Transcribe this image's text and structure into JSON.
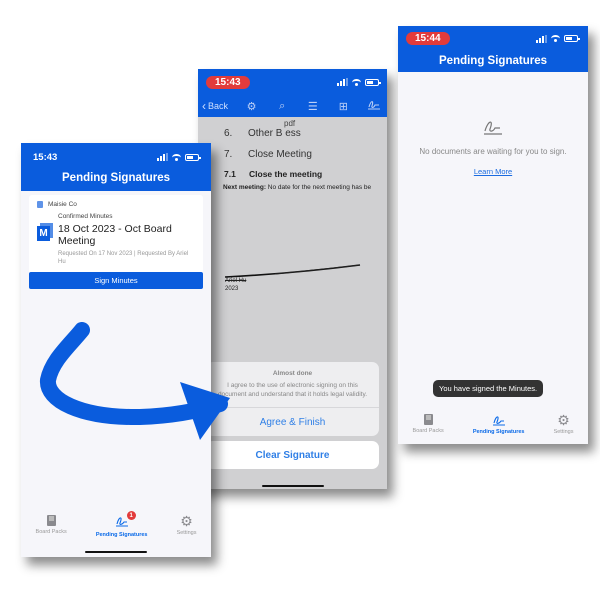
{
  "colors": {
    "brand_blue": "#0a5cdd",
    "badge_red": "#e23b3b",
    "link_blue": "#2f7fe6",
    "arrow_blue": "#0a5cdd"
  },
  "phone1": {
    "status_time": "15:43",
    "title": "Pending Signatures",
    "card": {
      "organization": "Maisie Co",
      "doc_type": "Confirmed Minutes",
      "doc_icon_letter": "M",
      "doc_title": "18 Oct 2023 - Oct Board Meeting",
      "meta": "Requested On 17 Nov 2023 | Requested By Ariel Hu",
      "action_label": "Sign Minutes"
    },
    "tabs": [
      {
        "label": "Board Packs",
        "icon": "book-icon",
        "active": false
      },
      {
        "label": "Pending Signatures",
        "icon": "signature-icon",
        "active": true,
        "badge": "1"
      },
      {
        "label": "Settings",
        "icon": "gear-icon",
        "active": false
      }
    ]
  },
  "phone2": {
    "status_time": "15:43",
    "toolbar": {
      "back_label": "Back",
      "icons": [
        "gear-icon",
        "search-icon",
        "list-icon",
        "grid-icon",
        "signature-icon"
      ]
    },
    "document": {
      "watermark": "pdf",
      "items": [
        {
          "num": "6.",
          "text": "Other B   ess"
        },
        {
          "num": "7.",
          "text": "Close Meeting"
        }
      ],
      "subitem": {
        "num": "7.1",
        "text": "Close the meeting"
      },
      "next_meeting_label": "Next meeting:",
      "next_meeting_text": " No date for the next meeting has be",
      "signer_name": "Ariel Hu",
      "signature_year": "2023"
    },
    "action_sheet": {
      "title": "Almost done",
      "message": "I agree to the use of electronic signing on this document and understand that it holds legal validity.",
      "agree_label": "Agree & Finish",
      "clear_label": "Clear Signature"
    }
  },
  "phone3": {
    "status_time": "15:44",
    "title": "Pending Signatures",
    "empty_message": "No documents are waiting for you to sign.",
    "learn_more_label": "Learn More",
    "toast": "You have signed the Minutes.",
    "tabs": [
      {
        "label": "Board Packs",
        "icon": "book-icon",
        "active": false
      },
      {
        "label": "Pending Signatures",
        "icon": "signature-icon",
        "active": true
      },
      {
        "label": "Settings",
        "icon": "gear-icon",
        "active": false
      }
    ]
  }
}
